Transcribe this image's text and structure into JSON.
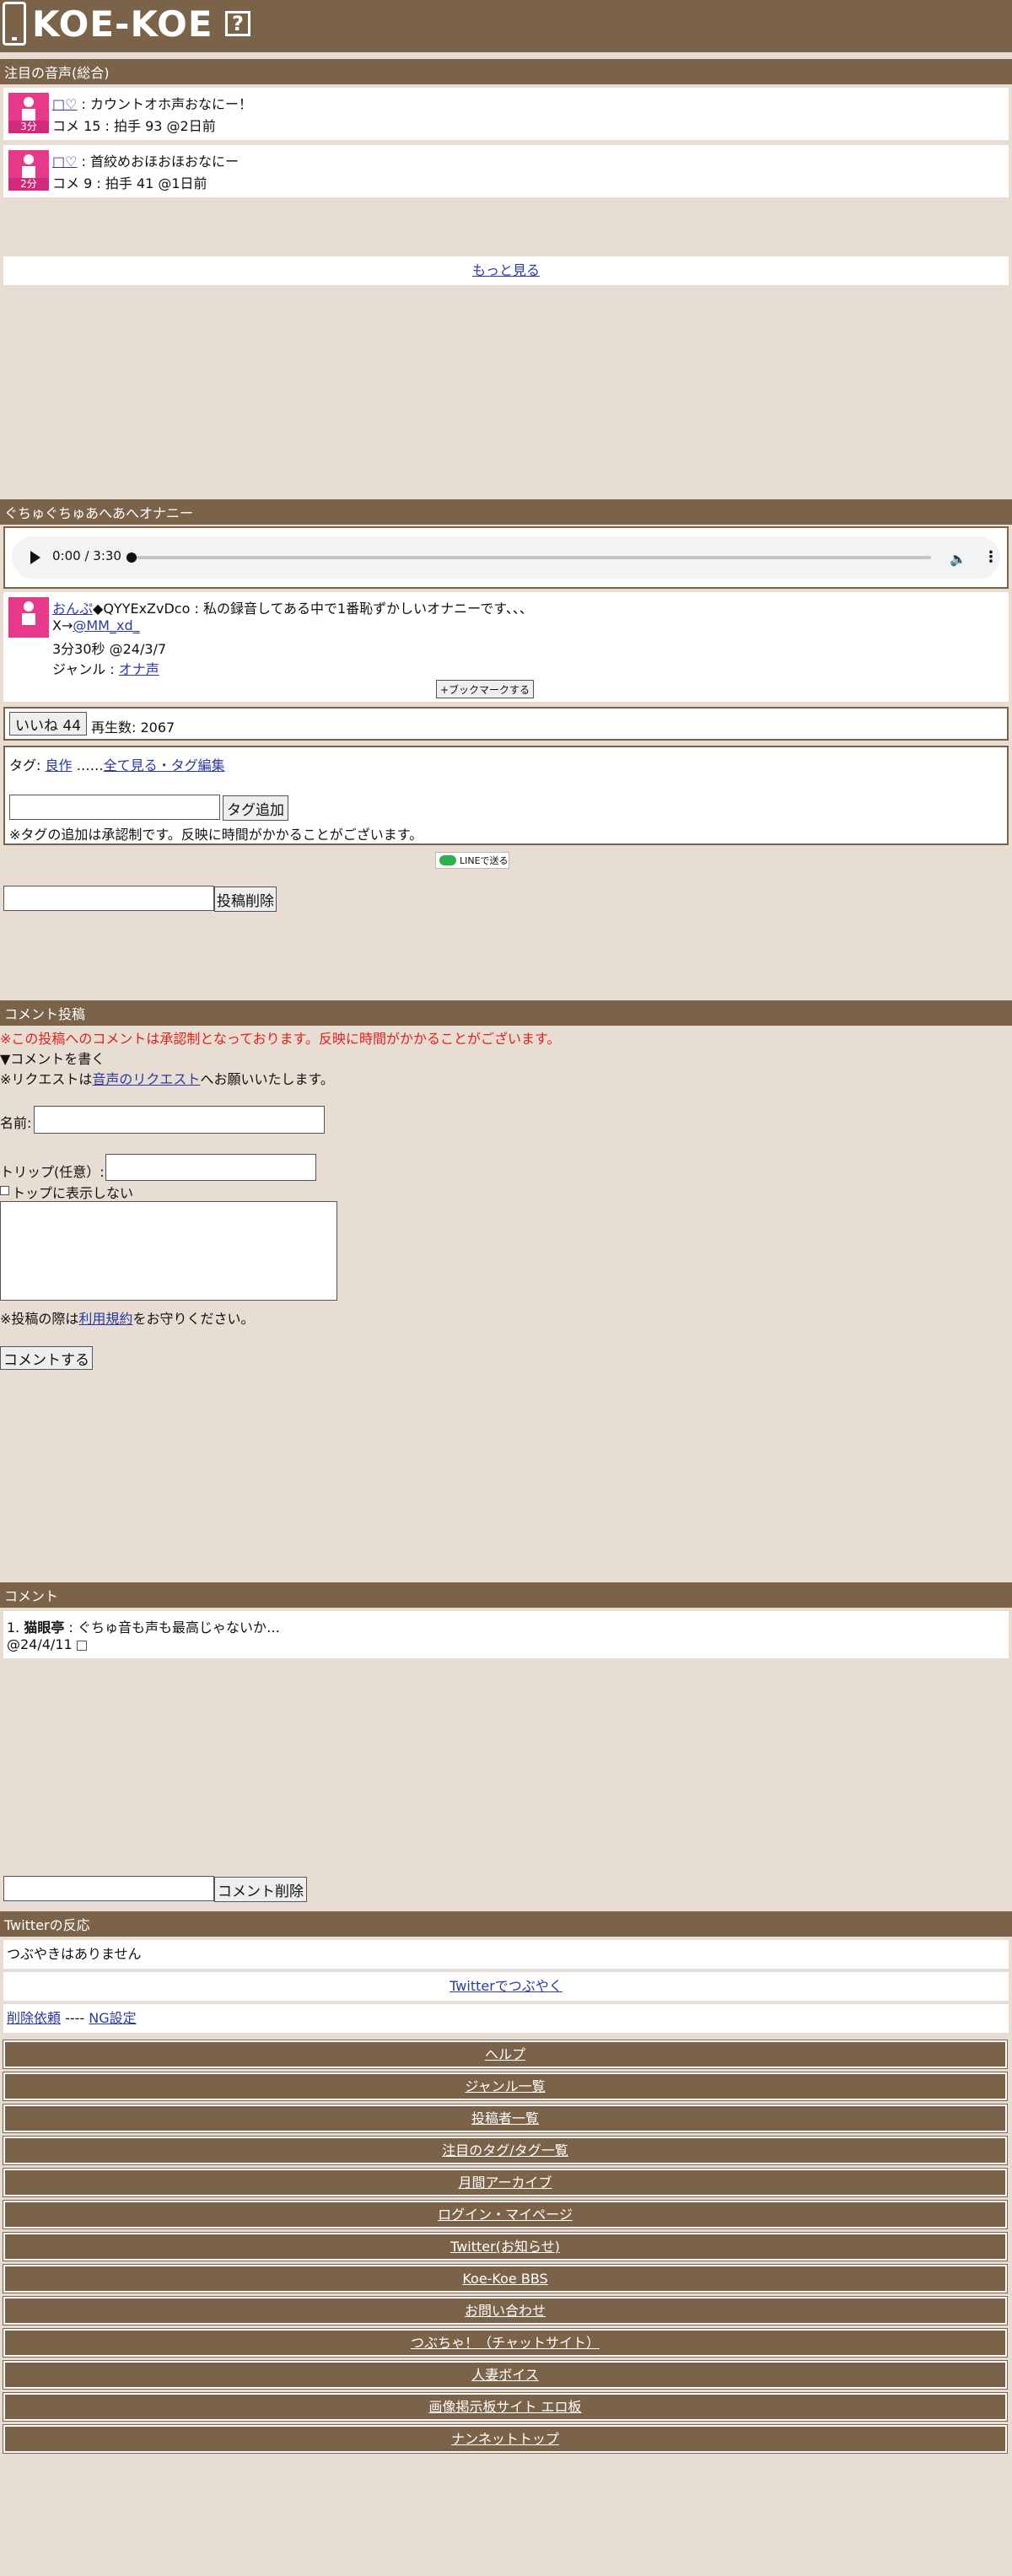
{
  "header": {
    "logo": "KOE-KOE",
    "help": "?"
  },
  "featured": {
    "title": "注目の音声(総合)",
    "items": [
      {
        "heart": "♡",
        "title": "カウントオホ声おなにー！",
        "meta": "コメ 15 : 拍手 93 @2日前",
        "duration": "3分"
      },
      {
        "heart": "♡",
        "title": "首絞めおほおほおなにー",
        "meta": "コメ 9 : 拍手 41 @1日前",
        "duration": "2分"
      }
    ],
    "more": "もっと見る"
  },
  "post": {
    "title": "ぐちゅぐちゅあへあへオナニー",
    "player": {
      "time": "0:00 / 3:30"
    },
    "author": "おんぷ",
    "author_rest": "◆QYYExZvDco : 私の録音してある中で1番恥ずかしいオナニーです、、、",
    "x_prefix": "X→",
    "x_handle": "@MM_xd_",
    "length_date": "3分30秒 @24/3/7",
    "genre_label": "ジャンル : ",
    "genre": "オナ声",
    "bookmark": "+ブックマークする",
    "like": "いいね 44",
    "plays": "再生数: 2067",
    "tags_label": "タグ: ",
    "tag": "良作",
    "tags_sep": " ……",
    "tags_all": "全て見る・タグ編集",
    "tag_add": "タグ追加",
    "tag_note": "※タグの追加は承認制です。反映に時間がかかることがございます。",
    "line_share": "LINEで送る",
    "delete_post": "投稿削除"
  },
  "comment_form": {
    "title": "コメント投稿",
    "warning": "※この投稿へのコメントは承認制となっております。反映に時間がかかることがございます。",
    "write": "▼コメントを書く",
    "request_prefix": "※リクエストは",
    "request_link": "音声のリクエスト",
    "request_suffix": "へお願いいたします。",
    "name_label": "名前:",
    "trip_label": "トリップ(任意）:",
    "hide_top": "トップに表示しない",
    "rules_prefix": "※投稿の際は",
    "rules_link": "利用規約",
    "rules_suffix": "をお守りください。",
    "submit": "コメントする"
  },
  "comments": {
    "title": "コメント",
    "items": [
      {
        "num": "1.",
        "name": "猫眼亭",
        "text": " : ぐちゅ音も声も最高じゃないか…",
        "date": "@24/4/11"
      }
    ],
    "delete": "コメント削除"
  },
  "twitter": {
    "title": "Twitterの反応",
    "empty": "つぶやきはありません",
    "tweet": "Twitterでつぶやく"
  },
  "report": {
    "delete_request": "削除依頼",
    "sep": " ---- ",
    "ng": "NG設定"
  },
  "footer_nav": [
    "ヘルプ",
    "ジャンル一覧",
    "投稿者一覧",
    "注目のタグ/タグ一覧",
    "月間アーカイブ",
    "ログイン・マイページ",
    "Twitter(お知らせ)",
    "Koe-Koe BBS",
    "お問い合わせ",
    "つぶちゃ！（チャットサイト）",
    "人妻ボイス",
    "画像掲示板サイト エロ板",
    "ナンネットトップ"
  ],
  "colors": {
    "brown": "#7a6349",
    "background": "#e8ddd2",
    "thumb_pink": "#e8388a",
    "warning_red": "#e0201f"
  }
}
